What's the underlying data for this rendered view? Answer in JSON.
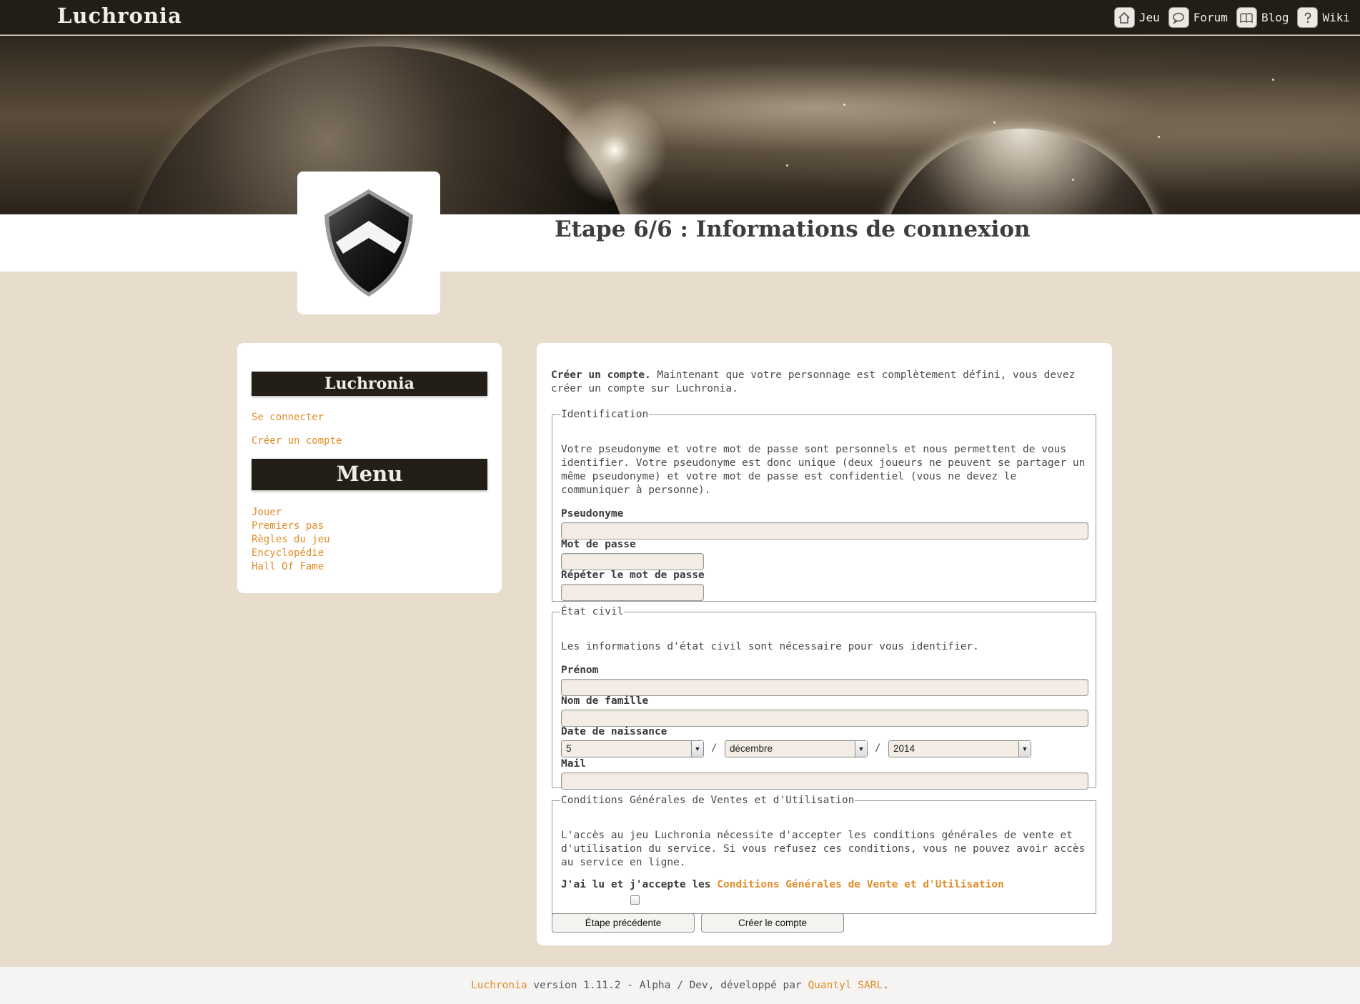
{
  "header": {
    "brand": "Luchronia",
    "nav": [
      {
        "label": "Jeu",
        "icon": "home-icon"
      },
      {
        "label": "Forum",
        "icon": "chat-bubble-icon"
      },
      {
        "label": "Blog",
        "icon": "book-icon"
      },
      {
        "label": "Wiki",
        "icon": "question-icon"
      }
    ]
  },
  "page_title": "Etape 6/6 : Informations de connexion",
  "sidebar": {
    "section1_title": "Luchronia",
    "section1_links": [
      "Se connecter",
      "Créer un compte"
    ],
    "section2_title": "Menu",
    "section2_links": [
      "Jouer",
      "Premiers pas",
      "Règles du jeu",
      "Encyclopédie",
      "Hall Of Fame"
    ]
  },
  "main": {
    "intro_bold": "Créer un compte.",
    "intro_text": " Maintenant que votre personnage est complètement défini, vous devez créer un compte sur Luchronia.",
    "identification": {
      "legend": "Identification",
      "description": "Votre pseudonyme et votre mot de passe sont personnels et nous permettent de vous identifier. Votre pseudonyme est donc unique (deux joueurs ne peuvent se partager un même pseudonyme) et votre mot de passe est confidentiel (vous ne devez le communiquer à personne).",
      "pseudo_label": "Pseudonyme",
      "pseudo_value": "",
      "password_label": "Mot de passe",
      "password_value": "",
      "repeat_label": "Répéter le mot de passe",
      "repeat_value": ""
    },
    "etat_civil": {
      "legend": "État civil",
      "description": "Les informations d'état civil sont nécessaire pour vous identifier.",
      "prenom_label": "Prénom",
      "prenom_value": "",
      "nom_label": "Nom de famille",
      "nom_value": "",
      "birth_label": "Date de naissance",
      "birth_day": "5",
      "birth_month": "décembre",
      "birth_year": "2014",
      "separator": "/",
      "mail_label": "Mail",
      "mail_value": ""
    },
    "cgu": {
      "legend": "Conditions Générales de Ventes et d'Utilisation",
      "description": "L'accès au jeu Luchronia nécessite d'accepter les conditions générales de vente et d'utilisation du service. Si vous refusez ces conditions, vous ne pouvez avoir accès au service en ligne.",
      "accept_text": "J'ai lu et j'accepte les ",
      "accept_link": "Conditions Générales de Vente et d'Utilisation",
      "accepted": false
    },
    "buttons": {
      "previous": "Étape précédente",
      "create": "Créer le compte"
    }
  },
  "footer": {
    "app_link": "Luchronia",
    "version_text": " version 1.11.2 - Alpha / Dev, développé par ",
    "company_link": "Quantyl SARL",
    "end": "."
  },
  "colors": {
    "accent": "#e08d2a",
    "header_bg": "#221d17",
    "page_bg": "#e8ddcc"
  }
}
